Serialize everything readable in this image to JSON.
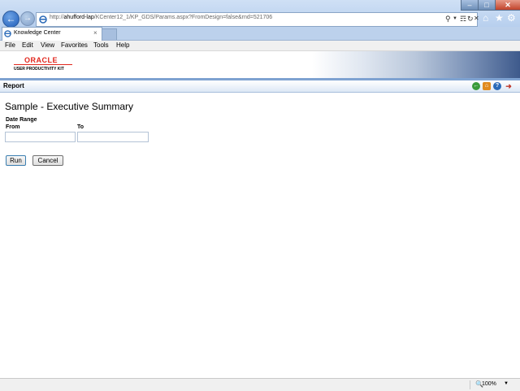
{
  "browser": {
    "address": {
      "prefix": "http://",
      "host": "ahufford-lap",
      "path": "/KCenter12_1/KP_GDS/Params.aspx?FromDesign=false&rnd=521706"
    },
    "tab_title": "Knowledge Center",
    "tab_close": "×",
    "menu": [
      "File",
      "Edit",
      "View",
      "Favorites",
      "Tools",
      "Help"
    ],
    "zoom": "100%",
    "window_buttons": {
      "minimize": "–",
      "maximize": "□",
      "close": "✕"
    }
  },
  "header": {
    "brand": "ORACLE",
    "brand_color": "#e1261c",
    "product": "USER PRODUCTIVITY KIT"
  },
  "toolbar": {
    "section_title": "Report",
    "icons": [
      "back-icon",
      "home-icon",
      "help-icon",
      "exit-icon"
    ]
  },
  "main": {
    "title": "Sample - Executive Summary",
    "date_range_label": "Date Range",
    "from_label": "From",
    "to_label": "To",
    "from_value": "",
    "to_value": "",
    "run_label": "Run",
    "cancel_label": "Cancel"
  }
}
